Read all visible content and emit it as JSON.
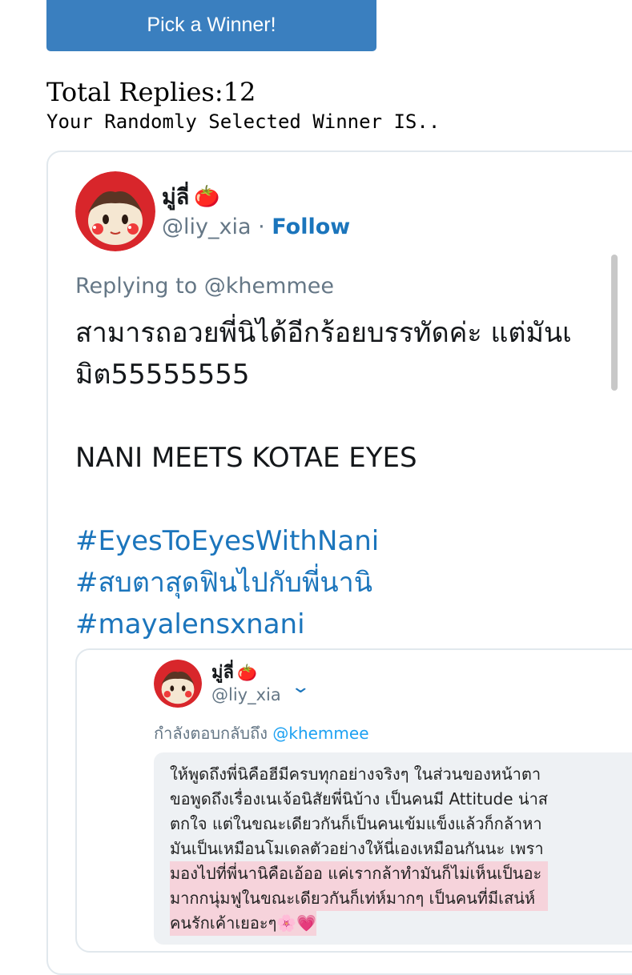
{
  "pick_button": {
    "label": "Pick a Winner!"
  },
  "summary": {
    "total_replies": "Total Replies:12",
    "winner_intro": "Your Randomly Selected Winner IS.."
  },
  "tweet": {
    "display_name": "มู่ลี่",
    "name_emoji": "🍅",
    "handle": "@liy_xia",
    "separator": "·",
    "follow_label": "Follow",
    "replying_to": "Replying to @khemmee",
    "text_lines": [
      "สามารถอวยพี่นิได้อีกร้อยบรรทัดค่ะ แต่มันเ",
      "มิต55555555",
      "",
      "NANI MEETS KOTAE EYES",
      ""
    ],
    "hashtags": [
      "#EyesToEyesWithNani",
      "#สบตาสุดฟินไปกับพี่นานิ",
      "#mayalensxnani"
    ],
    "quoted": {
      "display_name": "มู่ลี่",
      "name_emoji": "🍅",
      "handle": "@liy_xia",
      "chevron_icon": "chevron-down-icon",
      "reply_prefix": "กำลังตอบกลับถึง ",
      "reply_mention": "@khemmee",
      "lines": [
        "ให้พูดถึงพี่นิคือฮีมีครบทุกอย่างจริงๆ ในส่วนของหน้าตา",
        "ขอพูดถึงเรื่องเนเจ้อนิสัยพี่นิบ้าง เป็นคนมี Attitude น่าส",
        "ตกใจ แต่ในขณะเดียวกันก็เป็นคนเข้มแข็งแล้วก็กล้าหา",
        "มันเป็นเหมือนโมเดลตัวอย่างให้นี่เองเหมือนกันนะ เพรา",
        "มองไปที่พี่นานิคือเอ้ออ แค่เรากล้าทำมันก็ไม่เห็นเป็นอะ",
        "มากกนุ่มฟูในขณะเดียวกันก็เท่ห์มากๆ  เป็นคนที่มีเสน่ห์",
        "คนรักเค้าเยอะๆ🌸💗"
      ]
    }
  },
  "colors": {
    "button_bg": "#3a7fbf",
    "link_blue": "#1b75bc",
    "highlight": "#f6d3db"
  }
}
